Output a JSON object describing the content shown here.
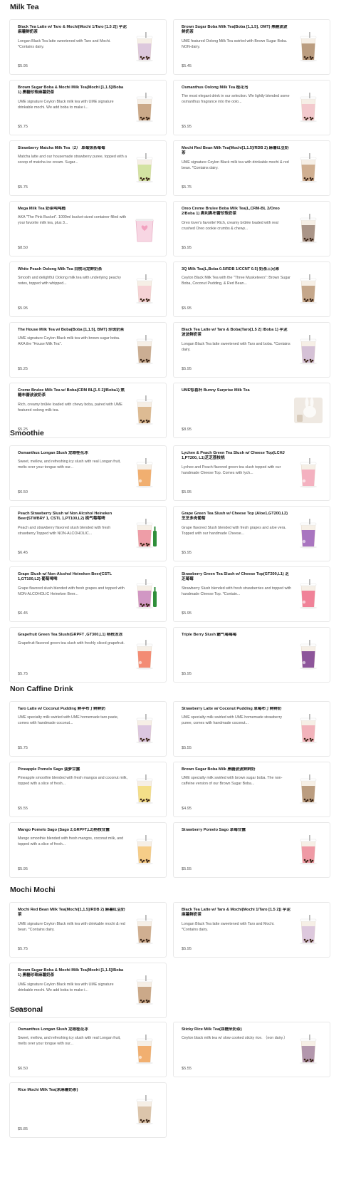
{
  "sections": [
    {
      "title": "Milk Tea",
      "items": [
        {
          "name": "Black Tea Latte w/ Taro & Mochi(Mochi 1/Taro [1.5 2]) 芋泥麻薯鲜奶茶",
          "desc": "Longan Black Tea latte sweetened with Taro and Mochi. *Contains dairy.",
          "price": "$5.95",
          "icon": "drink-cup-icon",
          "accent": "#c9a7d6"
        },
        {
          "name": "Brown Sugar Boba Milk Tea(Boba [1,1.5], OMT) 黑糖波波鲜奶茶",
          "desc": "UME featured Oolong Milk Tea swirled with Brown Sugar Boba. NON-dairy.",
          "price": "$5.45",
          "icon": "drink-cup-icon",
          "accent": "#8b5a2b"
        },
        {
          "name": "Brown Sugar Boba & Mochi Milk Tea(Mochi [1,1.5]/Boba 1) 黑糖珍珠麻薯奶茶",
          "desc": "UME signature Ceylon Black milk tea with UME signature drinkable mochi. We add boba to make i...",
          "price": "$5.75",
          "icon": "drink-cup-icon",
          "accent": "#a86f3c"
        },
        {
          "name": "Osmanthus Oolong Milk Tea 桂花乌",
          "desc": "The most elegant drink in our selection. We lightly blended some osmanthus fragrance into the oolo...",
          "price": "$5.95",
          "icon": "drink-cup-icon",
          "accent": "#f0a9b8"
        },
        {
          "name": "Strawberry Matcha Milk Tea（2） 草莓抹茶莓莓",
          "desc": "Matcha latte and our housemade strawberry puree, topped with a scoop of matcha ice cream. Sugar...",
          "price": "$5.75",
          "icon": "drink-cup-icon",
          "accent": "#b7d86a"
        },
        {
          "name": "Mochi Red Bean Milk Tea(Mochi[1,1.5]/RDB 2) 麻薯红豆奶茶",
          "desc": "UME signature Ceylon Black milk tea with drinkable mochi & red bean. *Contains dairy.",
          "price": "$5.75",
          "icon": "drink-cup-icon",
          "accent": "#b07a4a"
        },
        {
          "name": "Mega Milk Tea 奶茶吨吨桶",
          "desc": "AKA \"The Pink Bucket\". 1000ml bucket-sized container filled with your favorite milk tea, plus 3...",
          "price": "$8.50",
          "icon": "drink-bucket-icon",
          "accent": "#f2a1bf"
        },
        {
          "name": "Oreo Creme Brulee Boba Milk Tea(L,CRM-BL 2/Oreo 2/Boba 1) 奥利奥布蕾珍珠奶茶",
          "desc": "Oreo lover's favorite! Rich, creamy brûlée loaded with real crushed Oreo cookie crumbs & chewy...",
          "price": "$5.95",
          "icon": "drink-cup-icon",
          "accent": "#6b4a3a"
        },
        {
          "name": "White Peach Oolong Milk Tea 白桃乌龙鲜奶茶",
          "desc": "Smooth and delightful Oolong milk tea with underlying peachy notes, topped with whipped...",
          "price": "$5.95",
          "icon": "drink-cup-icon",
          "accent": "#f6b9c6"
        },
        {
          "name": "3Q Milk Tea(L,Boba 0.5/RDB 1/CCNT 0.5) 奶茶三兄弟",
          "desc": "Ceylon Black Milk Tea with the \"Three Musketeers\": Brown Sugar Boba, Coconut Pudding, & Red Bean...",
          "price": "$5.95",
          "icon": "drink-cup-icon",
          "accent": "#9c6b3f"
        },
        {
          "name": "The House Milk Tea w/ Boba(Boba [1,1.5], BMT) 珍珠奶茶",
          "desc": "UME signature Ceylon Black milk tea with brown sugar boba. AKA the \"House Milk Tea\".",
          "price": "$5.25",
          "icon": "drink-cup-icon",
          "accent": "#a8794f"
        },
        {
          "name": "Black Tea Latte w/ Taro & Boba(Taro[1.5 2] /Boba 1) 芋泥波波鲜奶茶",
          "desc": "Longan Black Tea latte sweetened with Taro and boba. *Contains dairy.",
          "price": "$5.95",
          "icon": "drink-cup-icon",
          "accent": "#b99bc9"
        },
        {
          "name": "Creme Brulee Milk Tea w/ Boba(CRM BL[1.5 2]/Boba1) 焦糖布蕾波波奶茶",
          "desc": "Rich, creamy brûlée loaded with chewy boba, paired with UME featured oolong milk tea.",
          "price": "$5.25",
          "icon": "drink-cup-icon",
          "accent": "#c98f4f"
        },
        {
          "name": "UME惊喜杯 Bunny Surprise Milk Tea",
          "desc": "",
          "price": "$8.95",
          "icon": "bunny-cup-icon",
          "accent": "#e8e0d6"
        }
      ]
    },
    {
      "title": "Smoothie",
      "items": [
        {
          "name": "Osmanthus Longan Slush 龙眼桂花冰",
          "desc": "Sweet, mellow, and refreshing icy slush with real Longan fruit, melts over your tongue with our...",
          "price": "$6.50",
          "icon": "slush-cup-icon",
          "accent": "#f0a35a"
        },
        {
          "name": "Lychee & Peach Green Tea Slush w/ Cheese Top(LCHJ 1,PT200, L1)芝芝荔枝桃",
          "desc": "Lychee and Peach flavored green tea slush topped with our handmade Cheese Top. Comes with lych...",
          "price": "$5.95",
          "icon": "slush-cup-icon",
          "accent": "#f3a6b9"
        },
        {
          "name": "Peach Strawberry Slush w/ Non Alcohol Heineken Beer(STWBRY 1, CSTL 1,PT100,L2) 桃气莓莓啤",
          "desc": "Peach and strawberry flavored slush blended with fresh strawberry.Topped with NON-ALCOHOLIC...",
          "price": "$6.45",
          "icon": "slush-beer-icon",
          "accent": "#e85a73"
        },
        {
          "name": "Grape Green Tea Slush w/ Cheese Top (Aloe1,GT200,L2)芝芝多肉葡萄",
          "desc": "Grape flavored Slush blended with fresh grapes and aloe vera. Topped with our handmade Cheese...",
          "price": "$5.95",
          "icon": "slush-cup-icon",
          "accent": "#9b5fb8"
        },
        {
          "name": "Grape Slush w/ Non-Alcohol Heineken Beer(CSTL 1,GT100,L2) 葡萄啤啤",
          "desc": "Grape flavored slush blended with fresh grapes and topped with NON-ALCOHOLIC Heineken Beer...",
          "price": "$6.45",
          "icon": "slush-beer-icon",
          "accent": "#b24fa8"
        },
        {
          "name": "Strawberry Green Tea Slush w/ Cheese Top(GT200,L1) 芝芝莓莓",
          "desc": "Strawberry Slush blended with fresh strawberries and topped with handmade Cheese Top. *Contain...",
          "price": "$5.95",
          "icon": "slush-cup-icon",
          "accent": "#ef6f8a"
        },
        {
          "name": "Grapefruit Green Tea Slush(GRPFT ,GT300,L1) 杨枝冻冻",
          "desc": "Grapefruit flavored green tea slush with freshly sliced grapefruit.",
          "price": "$5.75",
          "icon": "slush-cup-icon",
          "accent": "#f27a5f"
        },
        {
          "name": "Triple Berry Slush 霸气莓莓莓",
          "desc": "",
          "price": "$5.95",
          "icon": "slush-cup-icon",
          "accent": "#7a3a8c"
        }
      ]
    },
    {
      "title": "Non Caffine Drink",
      "items": [
        {
          "name": "Taro Latte w/ Coconut Pudding 鲜芋布丁鲜鲜奶",
          "desc": "UME specialty milk swirled with UME homemade taro paste, comes with handmade coconut...",
          "price": "$5.75",
          "icon": "drink-cup-icon",
          "accent": "#c7a6da"
        },
        {
          "name": "Strawberry Latte w/ Coconut Pudding 草莓布丁鲜鲜奶",
          "desc": "UME specialty milk swirled with UME homemade strawberry puree, comes with handmade coconut...",
          "price": "$5.55",
          "icon": "drink-cup-icon",
          "accent": "#ef8197"
        },
        {
          "name": "Pineapple Pomelo Sago 菠萝甘露",
          "desc": "Pineapple smoothie blended with fresh mangos and coconut milk, topped with a slice of fresh...",
          "price": "$5.55",
          "icon": "drink-cup-icon",
          "accent": "#f3d23c"
        },
        {
          "name": "Brown Sugar Boba Milk 黑糖波波鲜鲜奶",
          "desc": "UME specialty milk swirled with brown sugar boba. The non-caffeine version of our Brown Sugar Boba...",
          "price": "$4.95",
          "icon": "drink-cup-icon",
          "accent": "#8b5a2b"
        },
        {
          "name": "Mango Pomelo Sago (Sago 2,GRPFT,L2)杨枝甘露",
          "desc": "Mango smoothie blended with fresh mangos, coconut milk, and topped with a slice of fresh...",
          "price": "$5.95",
          "icon": "drink-cup-icon",
          "accent": "#f5b03a"
        },
        {
          "name": "Strawberry Pomelo Sago 草莓甘露",
          "desc": "",
          "price": "$5.55",
          "icon": "drink-cup-icon",
          "accent": "#e9546f"
        }
      ]
    },
    {
      "title": "Mochi Mochi",
      "items": [
        {
          "name": "Mochi Red Bean Milk Tea(Mochi[1,1.5]/RDB 2) 麻薯红豆奶茶",
          "desc": "UME signature Ceylon Black milk tea with drinkable mochi & red bean. *Contains dairy.",
          "price": "$5.75",
          "icon": "drink-cup-icon",
          "accent": "#b07a4a"
        },
        {
          "name": "Black Tea Latte w/ Taro & Mochi(Mochi 1/Taro [1.5 2]) 芋泥麻薯鲜奶茶",
          "desc": "Longan Black Tea latte sweetened with Taro and Mochi. *Contains dairy.",
          "price": "$5.95",
          "icon": "drink-cup-icon",
          "accent": "#c9a7d6"
        },
        {
          "name": "Brown Sugar Boba & Mochi Milk Tea(Mochi [1,1.5]/Boba 1) 黑糖珍珠麻薯奶茶",
          "desc": "UME signature Ceylon Black milk tea with UME signature drinkable mochi. We add boba to make i...",
          "price": "$5.75",
          "icon": "drink-cup-icon",
          "accent": "#a86f3c"
        }
      ]
    },
    {
      "title": "Seasonal",
      "items": [
        {
          "name": "Osmanthus Longan Slush 龙眼桂花冰",
          "desc": "Sweet, mellow, and refreshing icy slush with real Longan fruit, melts over your tongue with our...",
          "price": "$6.50",
          "icon": "slush-cup-icon",
          "accent": "#f0a35a"
        },
        {
          "name": "Sticky Rice Milk Tea(血糯米奶茶)",
          "desc": "Ceylon black milk tea w/ slow cooked sticky rice. （non dairy.）",
          "price": "$5.55",
          "icon": "drink-cup-icon",
          "accent": "#7c4f7e"
        },
        {
          "name": "Rice Mochi Milk Tea(米麻薯奶茶)",
          "desc": "",
          "price": "$5.85",
          "icon": "drink-cup-icon",
          "accent": "#c7a27a"
        }
      ]
    }
  ]
}
